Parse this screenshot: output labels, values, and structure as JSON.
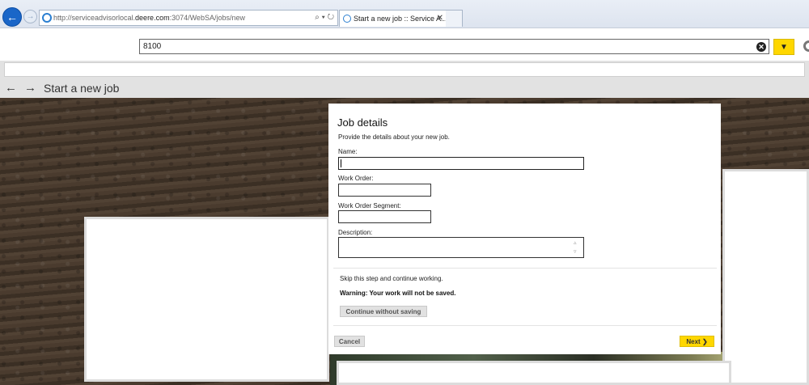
{
  "browser": {
    "url_prefix": "http://serviceadvisorlocal.",
    "url_host": "deere.com",
    "url_suffix": ":3074/WebSA/jobs/new",
    "tab_title": "Start a new job :: Service A...",
    "back_icon": "back-arrow-icon",
    "forward_icon": "forward-arrow-icon"
  },
  "toolbar": {
    "search_value": "8100",
    "clear_icon": "clear-icon",
    "dropdown_icon": "chevron-down-icon",
    "settings_icon": "gear-icon"
  },
  "page": {
    "back_glyph": "←",
    "forward_glyph": "→",
    "title": "Start a new job"
  },
  "dialog": {
    "title": "Job details",
    "subtitle": "Provide the details about your new job.",
    "fields": {
      "name_label": "Name:",
      "name_value": "",
      "work_order_label": "Work Order:",
      "work_order_value": "",
      "work_order_segment_label": "Work Order Segment:",
      "work_order_segment_value": "",
      "description_label": "Description:",
      "description_value": ""
    },
    "skip_text": "Skip this step and continue working.",
    "warning_text": "Warning: Your work will not be saved.",
    "continue_label": "Continue without saving",
    "cancel_label": "Cancel",
    "next_label": "Next"
  },
  "colors": {
    "accent_yellow": "#ffd700",
    "ie_blue": "#1a66c8",
    "soil_brown": "#43362a"
  }
}
